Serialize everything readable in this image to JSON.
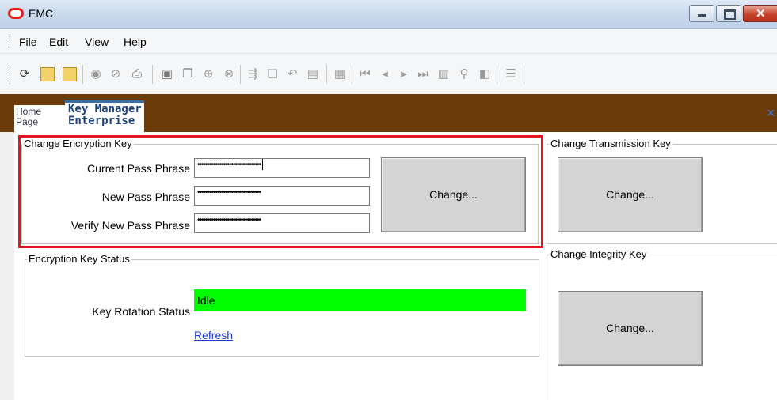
{
  "window": {
    "title": "EMC",
    "colors": {
      "title_icon": "#e02018",
      "tab_bar": "#6b3b0a",
      "status_ok": "#00ff00",
      "highlight": "#e8141b"
    }
  },
  "menu": {
    "items": [
      "File",
      "Edit",
      "View",
      "Help"
    ]
  },
  "toolbar": {
    "icons": [
      "refresh-icon",
      "open-folder-icon",
      "open-folder-alt-icon",
      "record-icon",
      "note-icon",
      "print-icon",
      "save-icon",
      "copy-pages-icon",
      "add-icon",
      "cancel-icon",
      "import-icon",
      "copy-icon",
      "undo-icon",
      "paste-icon",
      "table-icon",
      "first-record-icon",
      "previous-record-icon",
      "next-record-icon",
      "last-record-icon",
      "calendar-icon",
      "find-icon",
      "view-icon",
      "list-icon"
    ]
  },
  "tabs": {
    "home": {
      "line1": "Home",
      "line2": "Page"
    },
    "key_manager": {
      "line1": "Key Manager",
      "line2": "Enterprise"
    },
    "close_glyph": "×"
  },
  "encryption": {
    "title": "Change Encryption Key",
    "current_label": "Current Pass Phrase",
    "current_value": "••••••••••••••••••••••••••••••••",
    "new_label": "New Pass Phrase",
    "new_value": "••••••••••••••••••••••••••••••••",
    "verify_label": "Verify New Pass Phrase",
    "verify_value": "••••••••••••••••••••••••••••••••",
    "button": "Change..."
  },
  "transmission": {
    "title": "Change Transmission Key",
    "button": "Change..."
  },
  "status": {
    "title": "Encryption Key Status",
    "rotation_label": "Key Rotation Status",
    "rotation_value": "Idle",
    "refresh": "Refresh"
  },
  "integrity": {
    "title": "Change Integrity Key",
    "button": "Change..."
  }
}
